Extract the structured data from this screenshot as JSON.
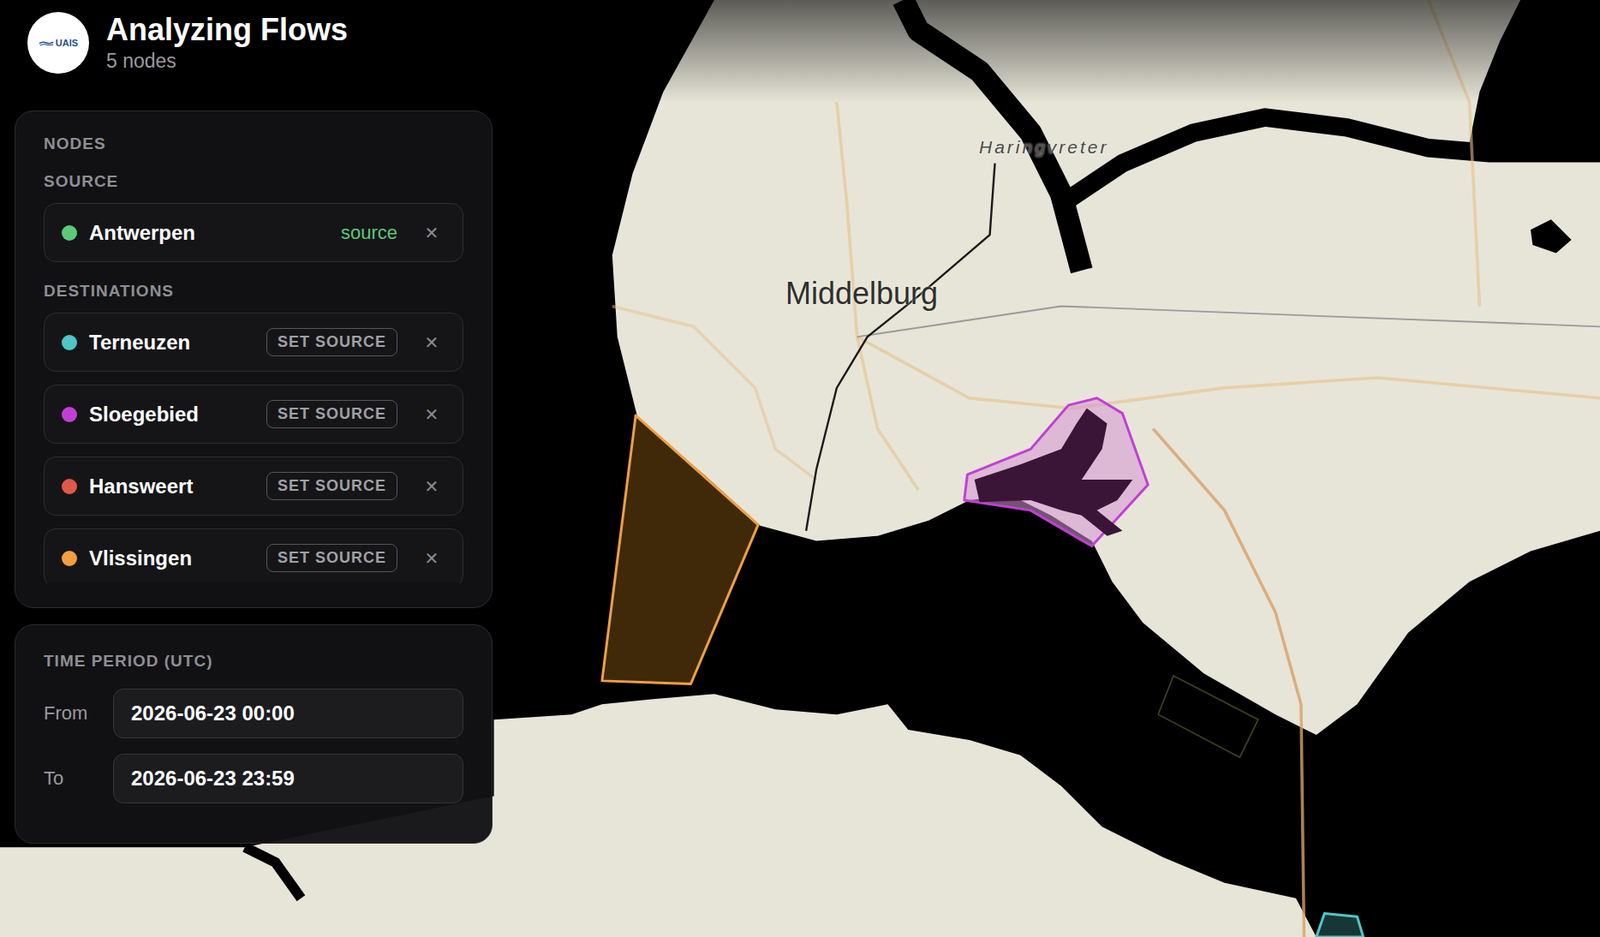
{
  "app": {
    "title": "Analyzing Flows",
    "subtitle": "5 nodes",
    "logo": "UAIS"
  },
  "nodes_panel": {
    "heading": "NODES",
    "source_heading": "SOURCE",
    "destinations_heading": "DESTINATIONS",
    "source": {
      "name": "Antwerpen",
      "badge": "source",
      "remove": "✕",
      "color": "#5cc97a"
    },
    "destinations": [
      {
        "name": "Terneuzen",
        "action": "SET SOURCE",
        "remove": "✕",
        "color": "#4fc6c6"
      },
      {
        "name": "Sloegebied",
        "action": "SET SOURCE",
        "remove": "✕",
        "color": "#c23fd6"
      },
      {
        "name": "Hansweert",
        "action": "SET SOURCE",
        "remove": "✕",
        "color": "#e0584a"
      },
      {
        "name": "Vlissingen",
        "action": "SET SOURCE",
        "remove": "✕",
        "color": "#f0a040"
      }
    ]
  },
  "time_period": {
    "heading": "TIME PERIOD (UTC)",
    "fields": [
      {
        "label": "From",
        "value": "2026-06-23 00:00"
      },
      {
        "label": "To",
        "value": "2026-06-23 23:59"
      }
    ]
  },
  "map": {
    "labels": [
      {
        "text": "Middelburg"
      },
      {
        "text": "Haringvreter"
      }
    ],
    "zones": [
      {
        "color": "#f0a040"
      },
      {
        "color": "#c23fd6"
      },
      {
        "color": "#4fc6c6"
      }
    ]
  }
}
